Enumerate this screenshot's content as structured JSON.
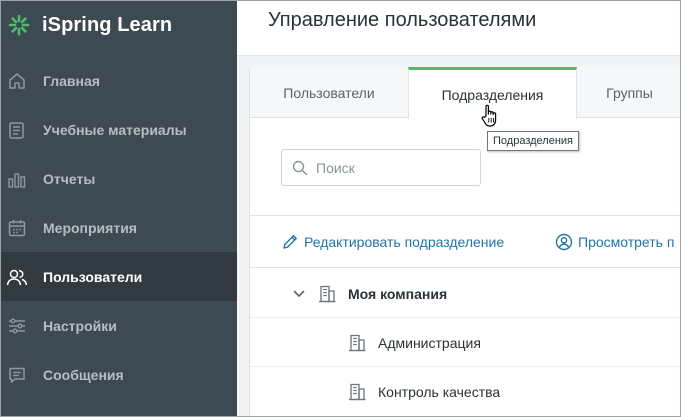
{
  "app": {
    "name": "iSpring Learn",
    "brand_color": "#4fbd6a",
    "sidebar_bg": "#3e4a51"
  },
  "sidebar": {
    "items": [
      {
        "label": "Главная",
        "icon": "home-icon"
      },
      {
        "label": "Учебные материалы",
        "icon": "book-icon"
      },
      {
        "label": "Отчеты",
        "icon": "bar-chart-icon"
      },
      {
        "label": "Мероприятия",
        "icon": "calendar-icon"
      },
      {
        "label": "Пользователи",
        "icon": "users-icon",
        "active": true
      },
      {
        "label": "Настройки",
        "icon": "sliders-icon"
      },
      {
        "label": "Сообщения",
        "icon": "message-icon"
      }
    ]
  },
  "header": {
    "title": "Управление пользователями"
  },
  "tabs": [
    {
      "label": "Пользователи"
    },
    {
      "label": "Подразделения",
      "active": true
    },
    {
      "label": "Группы"
    }
  ],
  "search": {
    "placeholder": "Поиск",
    "value": ""
  },
  "actions": {
    "edit_label": "Редактировать подразделение",
    "view_label": "Просмотреть п"
  },
  "tree": {
    "root": "Моя компания",
    "children": [
      "Администрация",
      "Контроль качества"
    ]
  },
  "tooltip": {
    "text": "Подразделения"
  },
  "colors": {
    "accent": "#4fbd6a",
    "link": "#2275a8"
  }
}
